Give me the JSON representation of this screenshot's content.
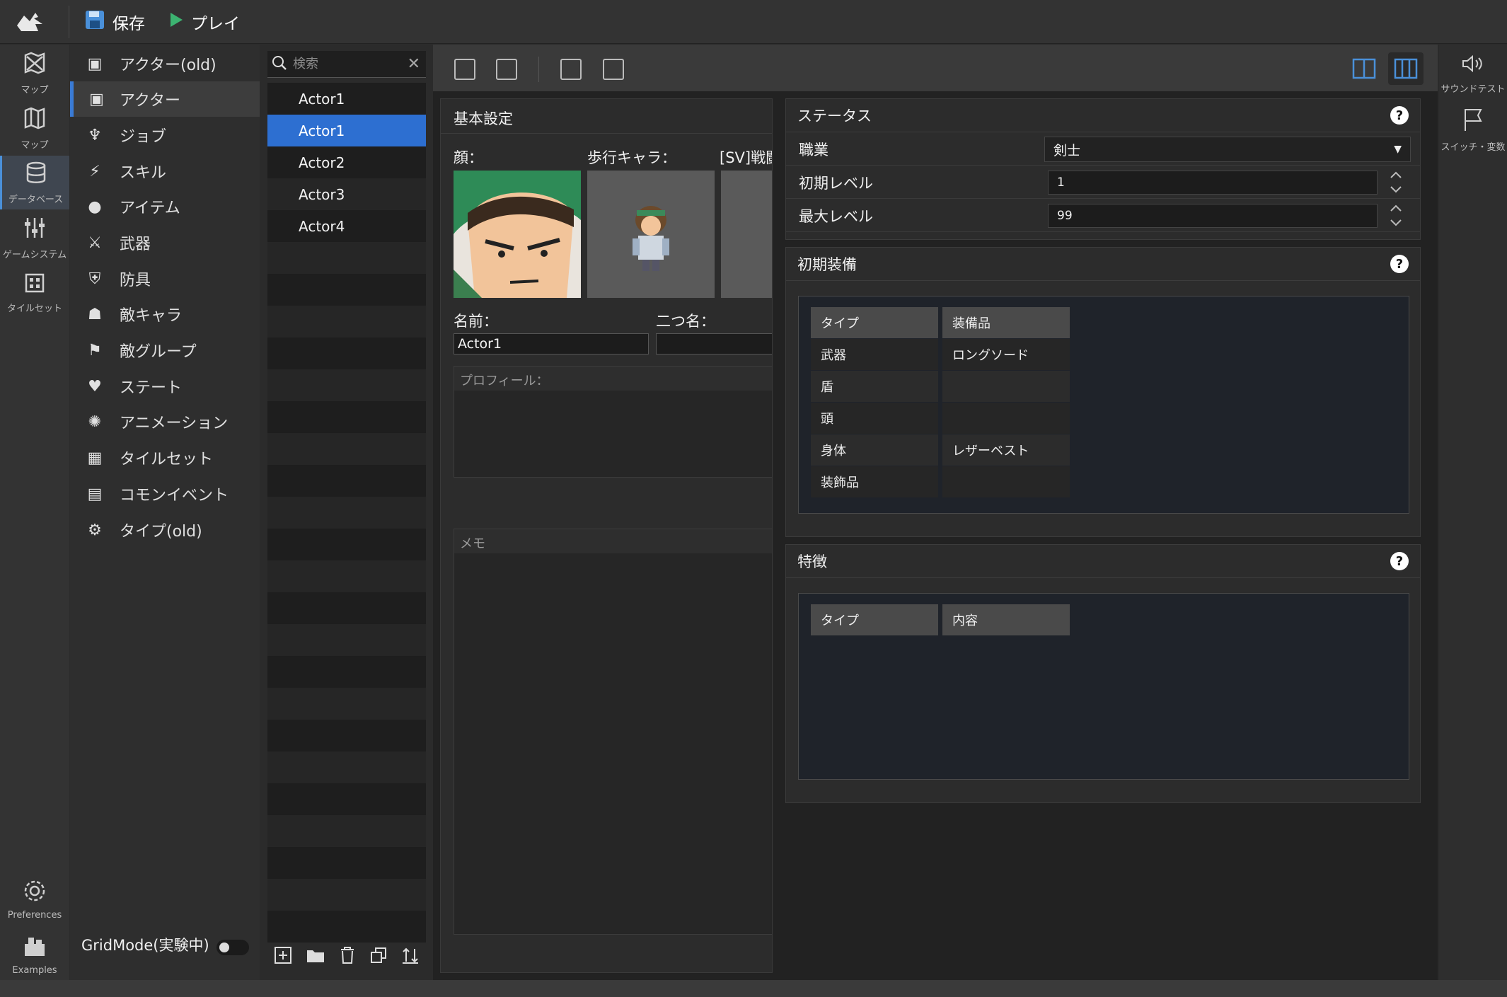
{
  "toolbar": {
    "save_label": "保存",
    "play_label": "プレイ"
  },
  "rail": [
    {
      "label": "マップ",
      "icon": "map-x-icon"
    },
    {
      "label": "マップ",
      "icon": "map-icon"
    },
    {
      "label": "データベース",
      "icon": "database-icon",
      "active": true
    },
    {
      "label": "ゲームシステム",
      "icon": "sliders-icon"
    },
    {
      "label": "タイルセット",
      "icon": "grid-icon"
    }
  ],
  "rail_bottom": {
    "preferences": "Preferences",
    "examples": "Examples"
  },
  "menu": {
    "items": [
      "アクター(old)",
      "アクター",
      "ジョブ",
      "スキル",
      "アイテム",
      "武器",
      "防具",
      "敵キャラ",
      "敵グループ",
      "ステート",
      "アニメーション",
      "タイルセット",
      "コモンイベント",
      "タイプ(old)"
    ],
    "active_index": 1,
    "gridmode_label": "GridMode(実験中)"
  },
  "list": {
    "search_placeholder": "検索",
    "items": [
      "Actor1",
      "Actor1",
      "Actor2",
      "Actor3",
      "Actor4"
    ],
    "selected_index": 1
  },
  "basic": {
    "title": "基本設定",
    "face_label": "顔：",
    "walk_label": "歩行キャラ：",
    "sv_label": "[SV]戦闘",
    "name_label": "名前：",
    "name_value": "Actor1",
    "nickname_label": "二つ名：",
    "nickname_value": "",
    "profile_label": "プロフィール：",
    "memo_label": "メモ"
  },
  "status": {
    "title": "ステータス",
    "class_label": "職業",
    "class_value": "剣士",
    "initial_level_label": "初期レベル",
    "initial_level_value": "1",
    "max_level_label": "最大レベル",
    "max_level_value": "99"
  },
  "equipment": {
    "title": "初期装備",
    "headers": [
      "タイプ",
      "装備品"
    ],
    "rows": [
      [
        "武器",
        "ロングソード"
      ],
      [
        "盾",
        ""
      ],
      [
        "頭",
        ""
      ],
      [
        "身体",
        "レザーベスト"
      ],
      [
        "装飾品",
        ""
      ]
    ]
  },
  "traits": {
    "title": "特徴",
    "headers": [
      "タイプ",
      "内容"
    ]
  },
  "right_rail": {
    "sound_test": "サウンドテスト",
    "switch_var": "スイッチ・変数"
  },
  "colors": {
    "accent": "#2d6fd1",
    "play": "#3cb371",
    "save": "#4a90d9"
  }
}
